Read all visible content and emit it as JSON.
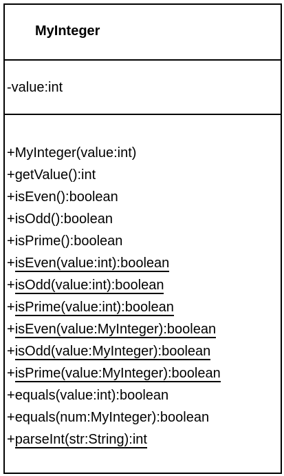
{
  "class_diagram": {
    "class_name": "MyInteger",
    "attributes": [
      {
        "text": "-value:int"
      }
    ],
    "methods": [
      {
        "visibility": "+",
        "signature": "MyInteger(value:int)",
        "static": false
      },
      {
        "visibility": "+",
        "signature": "getValue():int",
        "static": false
      },
      {
        "visibility": "+",
        "signature": "isEven():boolean",
        "static": false
      },
      {
        "visibility": "+",
        "signature": "isOdd():boolean",
        "static": false
      },
      {
        "visibility": "+",
        "signature": "isPrime():boolean",
        "static": false
      },
      {
        "visibility": "+",
        "signature": "isEven(value:int):boolean",
        "static": true
      },
      {
        "visibility": "+",
        "signature": "isOdd(value:int):boolean",
        "static": true
      },
      {
        "visibility": "+",
        "signature": "isPrime(value:int):boolean",
        "static": true
      },
      {
        "visibility": "+",
        "signature": "isEven(value:MyInteger):boolean",
        "static": true
      },
      {
        "visibility": "+",
        "signature": "isOdd(value:MyInteger):boolean",
        "static": true
      },
      {
        "visibility": "+",
        "signature": "isPrime(value:MyInteger):boolean",
        "static": true
      },
      {
        "visibility": "+",
        "signature": "equals(value:int):boolean",
        "static": false
      },
      {
        "visibility": "+",
        "signature": "equals(num:MyInteger):boolean",
        "static": false
      },
      {
        "visibility": "+",
        "signature": "parseInt(str:String):int",
        "static": true
      }
    ]
  }
}
